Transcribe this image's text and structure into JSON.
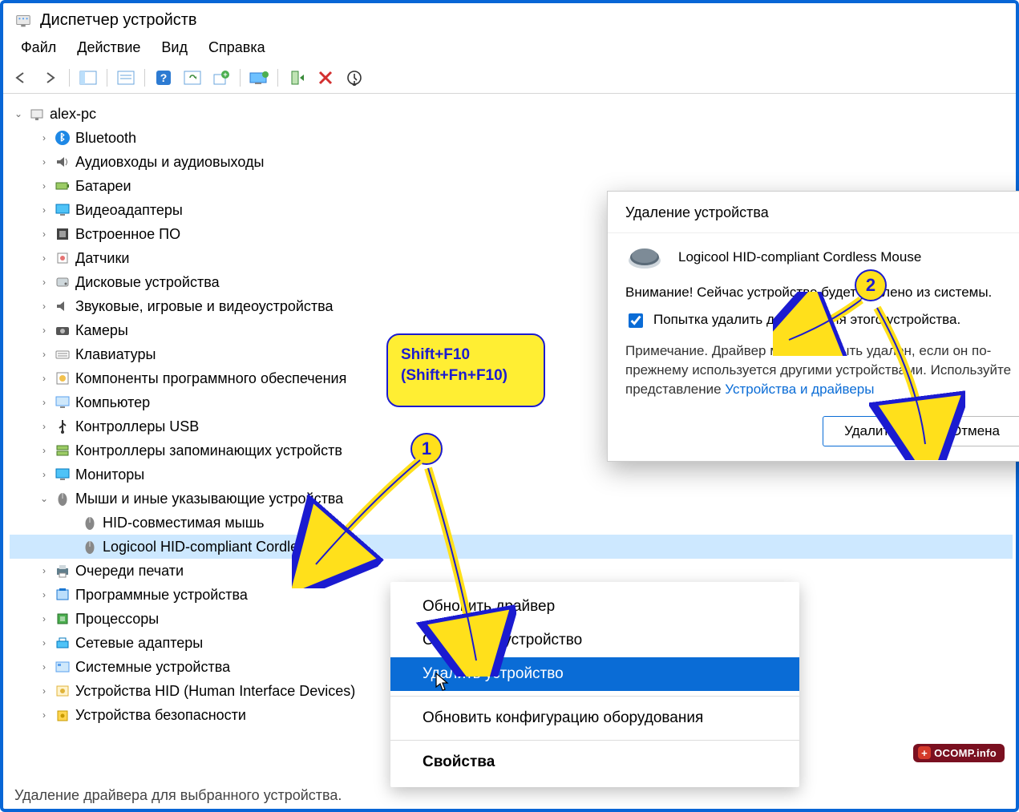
{
  "window": {
    "title": "Диспетчер устройств"
  },
  "menu": {
    "file": "Файл",
    "action": "Действие",
    "view": "Вид",
    "help": "Справка"
  },
  "toolbar_icons": [
    "back",
    "forward",
    "props-pane",
    "props",
    "help",
    "scan",
    "add-legacy",
    "monitor",
    "enable",
    "uninstall",
    "update"
  ],
  "tree": {
    "root": "alex-pc",
    "items": [
      {
        "label": "Bluetooth",
        "icon": "bluetooth"
      },
      {
        "label": "Аудиовходы и аудиовыходы",
        "icon": "audio"
      },
      {
        "label": "Батареи",
        "icon": "battery"
      },
      {
        "label": "Видеоадаптеры",
        "icon": "display"
      },
      {
        "label": "Встроенное ПО",
        "icon": "firmware"
      },
      {
        "label": "Датчики",
        "icon": "sensor"
      },
      {
        "label": "Дисковые устройства",
        "icon": "disk"
      },
      {
        "label": "Звуковые, игровые и видеоустройства",
        "icon": "sound"
      },
      {
        "label": "Камеры",
        "icon": "camera"
      },
      {
        "label": "Клавиатуры",
        "icon": "keyboard"
      },
      {
        "label": "Компоненты программного обеспечения",
        "icon": "software"
      },
      {
        "label": "Компьютер",
        "icon": "computer"
      },
      {
        "label": "Контроллеры USB",
        "icon": "usb"
      },
      {
        "label": "Контроллеры запоминающих устройств",
        "icon": "storage"
      },
      {
        "label": "Мониторы",
        "icon": "monitor"
      },
      {
        "label": "Мыши и иные указывающие устройства",
        "icon": "mouse",
        "expanded": true,
        "children": [
          {
            "label": "HID-совместимая мышь",
            "icon": "mouse"
          },
          {
            "label": "Logicool HID-compliant Cordless Mouse",
            "icon": "mouse",
            "selected": true
          }
        ]
      },
      {
        "label": "Очереди печати",
        "icon": "printer"
      },
      {
        "label": "Программные устройства",
        "icon": "software-dev"
      },
      {
        "label": "Процессоры",
        "icon": "cpu"
      },
      {
        "label": "Сетевые адаптеры",
        "icon": "network"
      },
      {
        "label": "Системные устройства",
        "icon": "system"
      },
      {
        "label": "Устройства HID (Human Interface Devices)",
        "icon": "hid"
      },
      {
        "label": "Устройства безопасности",
        "icon": "security"
      }
    ]
  },
  "context_menu": {
    "items": [
      {
        "label": "Обновить драйвер"
      },
      {
        "label": "Отключить устройство"
      },
      {
        "label": "Удалить устройство",
        "hovered": true
      },
      {
        "sep": true
      },
      {
        "label": "Обновить конфигурацию оборудования"
      },
      {
        "sep": true
      },
      {
        "label": "Свойства",
        "bold": true
      }
    ]
  },
  "dialog": {
    "title": "Удаление устройства",
    "device": "Logicool HID-compliant Cordless Mouse",
    "warning": "Внимание! Сейчас устройство будет удалено из системы.",
    "checkbox_label": "Попытка удалить драйвер для этого устройства.",
    "checkbox_checked": true,
    "note_pre": "Примечание. Драйвер может не быть удален, если он по-прежнему используется другими устройствами. Используйте представление ",
    "note_link": "Устройства и драйверы",
    "delete_btn": "Удалить",
    "cancel_btn": "Отмена"
  },
  "callout": {
    "line1": "Shift+F10",
    "line2": "(Shift+Fn+F10)"
  },
  "badges": {
    "b1": "1",
    "b2": "2"
  },
  "statusbar": "Удаление драйвера для выбранного устройства.",
  "watermark": "OCOMP.info"
}
